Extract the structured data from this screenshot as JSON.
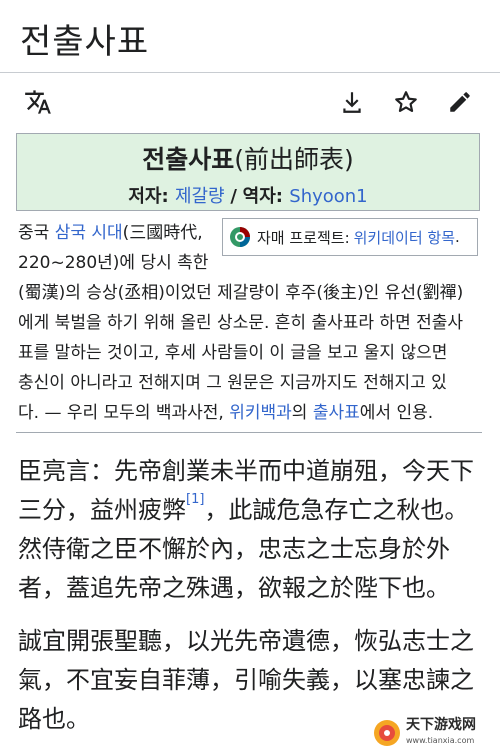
{
  "page": {
    "title": "전출사표"
  },
  "toolbar": {
    "icons": [
      "translate-icon",
      "download-icon",
      "star-icon",
      "edit-icon"
    ]
  },
  "header": {
    "title_main": "전출사표",
    "title_hanja": "(前出師表)",
    "author_label": "저자",
    "author_name": "제갈량",
    "separator": "/",
    "translator_label": "역자",
    "translator_name": "Shyoon1"
  },
  "wikidata_box": {
    "label": "자매 프로젝트:",
    "link": "위키데이터 항목",
    "suffix": "."
  },
  "notice": {
    "line1_a": "중국 ",
    "line1_link": "삼국 시대",
    "line1_b": "(三國時代,",
    "line2": "220~280년)에 당시 촉한",
    "line3": "(蜀漢)의 승상(丞相)이었던 제갈량이 후주(後主)인 유선(劉禪)",
    "line4": "에게 북벌을 하기 위해 올린 상소문. 흔히 출사표라 하면 전출사",
    "line5": "표를 말하는 것이고, 후세 사람들이 이 글을 보고 울지 않으면",
    "line6": "충신이 아니라고 전해지며 그 원문은 지금까지도 전해지고 있",
    "line7_a": "다. — 우리 모두의 백과사전, ",
    "line7_link1": "위키백과",
    "line7_b": "의 ",
    "line7_link2": "출사표",
    "line7_c": "에서 인용."
  },
  "body": {
    "p1_l1": "臣亮言：先帝創業未半而中道崩殂，今天下",
    "p1_l2a": "三分，益州疲弊",
    "p1_l2_ref": "[1]",
    "p1_l2b": "，此誠危急存亡之秋也。",
    "p1_l3": "然侍衛之臣不懈於內，忠志之士忘身於外",
    "p1_l4": "者，蓋追先帝之殊遇，欲報之於陛下也。",
    "p2_l1": "誠宜開張聖聽，以光先帝遺德，恢弘志士之",
    "p2_l2": "氣，不宜妄自菲薄，引喻失義，以塞忠諫之",
    "p2_l3": "路也。"
  },
  "watermark": {
    "name": "天下游戏网",
    "url": "www.tianxia.com"
  },
  "colors": {
    "link": "#3366cc",
    "header_bg": "#dff2e1",
    "text": "#202122",
    "border": "#a2a9b1"
  }
}
